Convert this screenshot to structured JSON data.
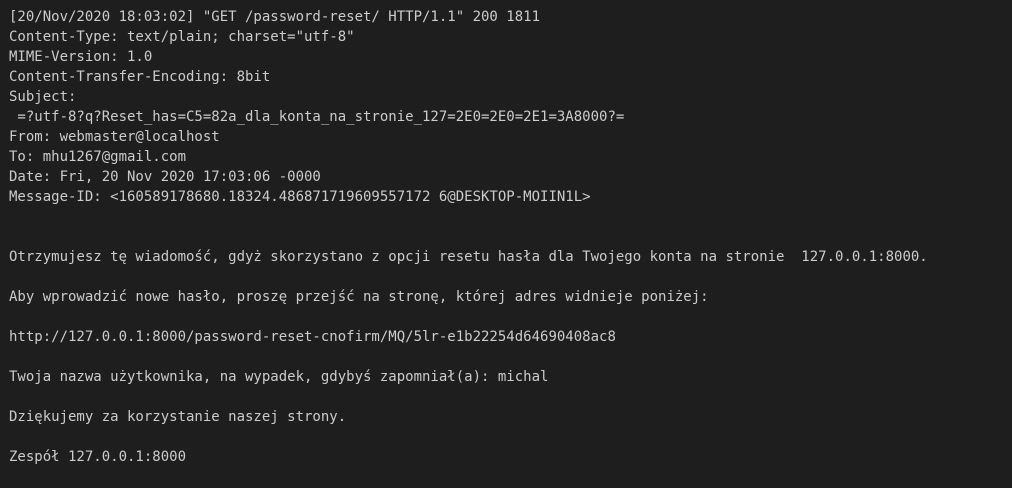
{
  "terminal": {
    "lines": [
      "[20/Nov/2020 18:03:02] \"GET /password-reset/ HTTP/1.1\" 200 1811",
      "Content-Type: text/plain; charset=\"utf-8\"",
      "MIME-Version: 1.0",
      "Content-Transfer-Encoding: 8bit",
      "Subject:",
      " =?utf-8?q?Reset_has=C5=82a_dla_konta_na_stronie_127=2E0=2E0=2E1=3A8000?=",
      "From: webmaster@localhost",
      "To: mhu1267@gmail.com",
      "Date: Fri, 20 Nov 2020 17:03:06 -0000",
      "Message-ID: <160589178680.18324.486871719609557172 6@DESKTOP-MOIIN1L>",
      "",
      "",
      "Otrzymujesz tę wiadomość, gdyż skorzystano z opcji resetu hasła dla Twojego konta na stronie  127.0.0.1:8000.",
      "",
      "Aby wprowadzić nowe hasło, proszę przejść na stronę, której adres widnieje poniżej:",
      "",
      "http://127.0.0.1:8000/password-reset-cnofirm/MQ/5lr-e1b22254d64690408ac8",
      "",
      "Twoja nazwa użytkownika, na wypadek, gdybyś zapomniał(a): michal",
      "",
      "Dziękujemy za korzystanie naszej strony.",
      "",
      "Zespół 127.0.0.1:8000"
    ]
  }
}
